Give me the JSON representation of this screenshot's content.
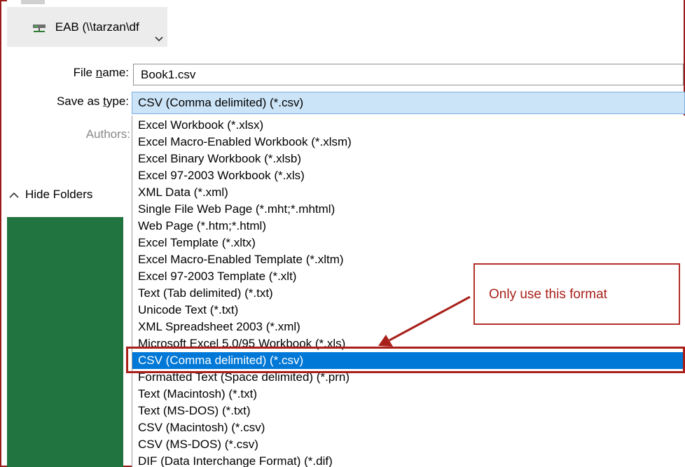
{
  "nav": {
    "item_label": "EAB (\\\\tarzan\\df",
    "item_icon": "network-drive-icon",
    "chevron_icon": "chevron-down-icon"
  },
  "form": {
    "filename_label_pre": "File ",
    "filename_label_u": "n",
    "filename_label_post": "ame:",
    "filename_value": "Book1.csv",
    "type_label_pre": "Save as ",
    "type_label_u": "t",
    "type_label_post": "ype:",
    "type_value": "CSV (Comma delimited) (*.csv)",
    "authors_label": "Authors:"
  },
  "hide_folders": {
    "label": "Hide Folders",
    "icon": "chevron-up-icon"
  },
  "type_options": [
    "Excel Workbook (*.xlsx)",
    "Excel Macro-Enabled Workbook (*.xlsm)",
    "Excel Binary Workbook (*.xlsb)",
    "Excel 97-2003 Workbook (*.xls)",
    "XML Data (*.xml)",
    "Single File Web Page (*.mht;*.mhtml)",
    "Web Page (*.htm;*.html)",
    "Excel Template (*.xltx)",
    "Excel Macro-Enabled Template (*.xltm)",
    "Excel 97-2003 Template (*.xlt)",
    "Text (Tab delimited) (*.txt)",
    "Unicode Text (*.txt)",
    "XML Spreadsheet 2003 (*.xml)",
    "Microsoft Excel 5.0/95 Workbook (*.xls)",
    "CSV (Comma delimited) (*.csv)",
    "Formatted Text (Space delimited) (*.prn)",
    "Text (Macintosh) (*.txt)",
    "Text (MS-DOS) (*.txt)",
    "CSV (Macintosh) (*.csv)",
    "CSV (MS-DOS) (*.csv)",
    "DIF (Data Interchange Format) (*.dif)"
  ],
  "selected_option_index": 14,
  "annotation": {
    "text": "Only use this format",
    "color": "#a8201a"
  },
  "colors": {
    "selection": "#0078d7",
    "combo_focus": "#cce4f7",
    "excel_green": "#21733f"
  }
}
